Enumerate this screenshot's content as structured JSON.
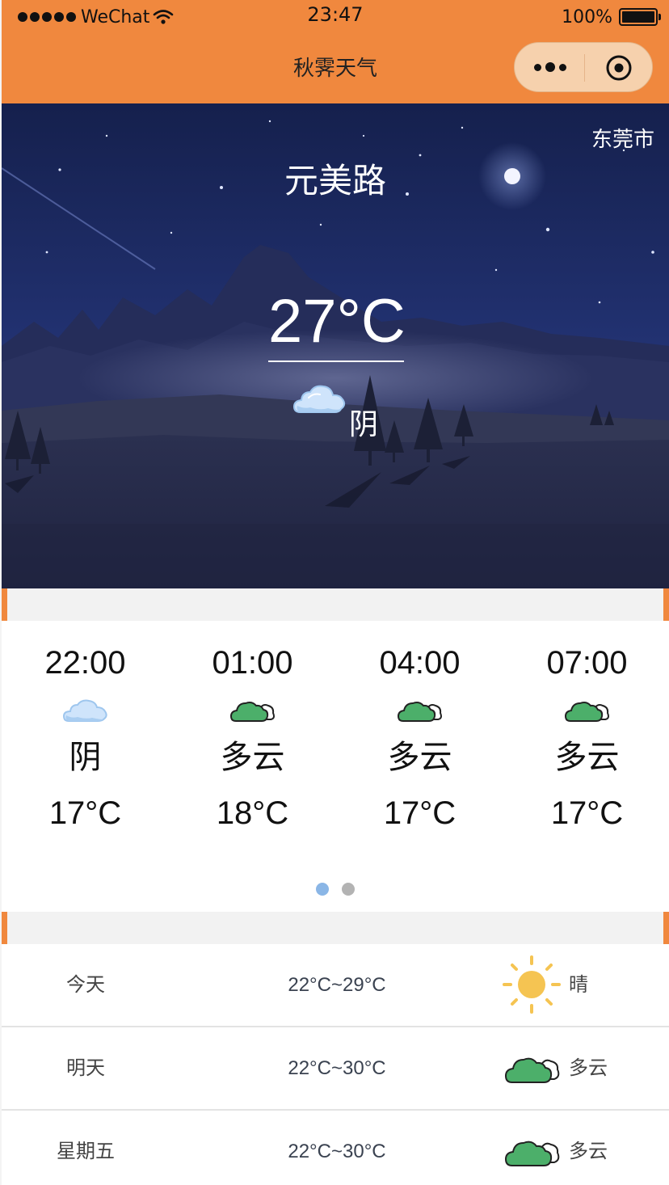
{
  "status_bar": {
    "carrier": "WeChat",
    "time": "23:47",
    "battery": "100%"
  },
  "nav": {
    "title": "秋霁天气",
    "menu_icon": "more-dots-icon",
    "close_icon": "target-close-icon"
  },
  "current": {
    "city": "东莞市",
    "street": "元美路",
    "temperature": "27°C",
    "condition": "阴",
    "icon": "overcast-cloud-icon"
  },
  "hourly": [
    {
      "time": "22:00",
      "icon": "overcast-cloud-icon",
      "condition": "阴",
      "temp": "17°C"
    },
    {
      "time": "01:00",
      "icon": "partly-cloudy-icon",
      "condition": "多云",
      "temp": "18°C"
    },
    {
      "time": "04:00",
      "icon": "partly-cloudy-icon",
      "condition": "多云",
      "temp": "17°C"
    },
    {
      "time": "07:00",
      "icon": "partly-cloudy-icon",
      "condition": "多云",
      "temp": "17°C"
    }
  ],
  "hourly_pager": {
    "pages": 2,
    "active": 0
  },
  "daily": [
    {
      "day": "今天",
      "range": "22°C~29°C",
      "icon": "sun-icon",
      "condition": "晴"
    },
    {
      "day": "明天",
      "range": "22°C~30°C",
      "icon": "partly-cloudy-icon",
      "condition": "多云"
    },
    {
      "day": "星期五",
      "range": "22°C~30°C",
      "icon": "partly-cloudy-icon",
      "condition": "多云"
    }
  ],
  "colors": {
    "accent": "#f0883e",
    "night_sky": "#1e2a5e",
    "pager_active": "#8ab6e6",
    "pager_inactive": "#b3b3b3",
    "sun": "#f5c452",
    "cloud_green": "#4caf6a"
  }
}
